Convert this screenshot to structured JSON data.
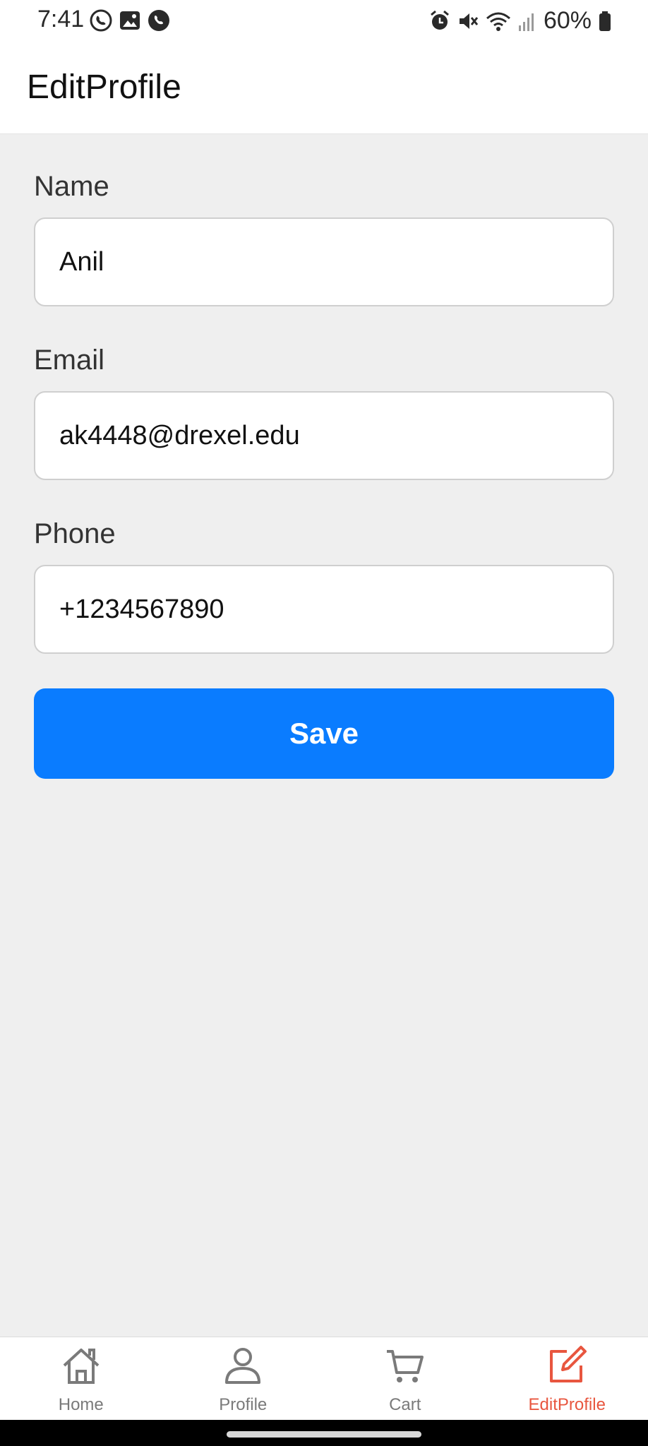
{
  "status_bar": {
    "time": "7:41",
    "battery": "60%",
    "left_icons": [
      "whatsapp-icon",
      "gallery-icon",
      "phone-app-icon"
    ],
    "right_icons": [
      "alarm-icon",
      "mute-icon",
      "wifi-icon",
      "signal-icon",
      "battery-icon"
    ]
  },
  "header": {
    "title": "EditProfile"
  },
  "form": {
    "name_label": "Name",
    "name_value": "Anil",
    "email_label": "Email",
    "email_value": "ak4448@drexel.edu",
    "phone_label": "Phone",
    "phone_value": "+1234567890",
    "save_label": "Save"
  },
  "tabs": [
    {
      "label": "Home",
      "icon": "home-icon",
      "active": false
    },
    {
      "label": "Profile",
      "icon": "user-icon",
      "active": false
    },
    {
      "label": "Cart",
      "icon": "cart-icon",
      "active": false
    },
    {
      "label": "EditProfile",
      "icon": "edit-icon",
      "active": true
    }
  ],
  "colors": {
    "accent": "#0a7cff",
    "active_tab": "#e8563f",
    "inactive_tab": "#7a7a7a",
    "background": "#efefef"
  }
}
